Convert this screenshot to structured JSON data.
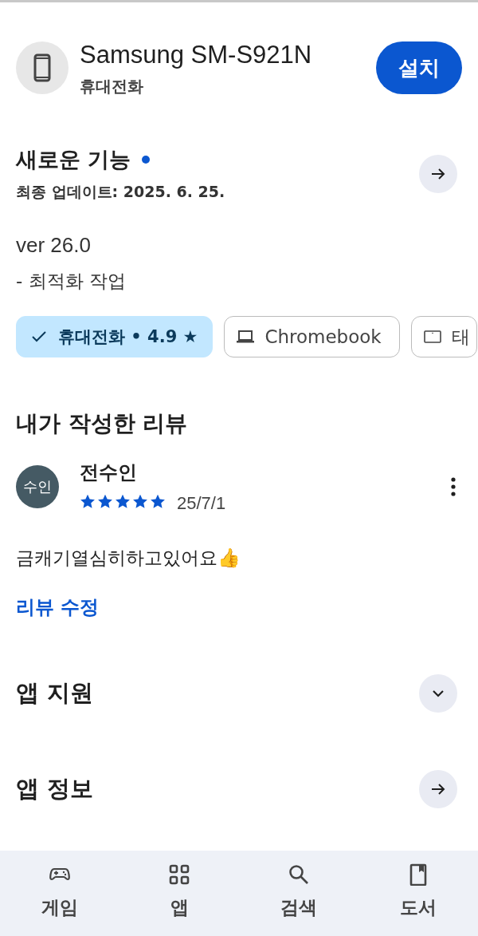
{
  "device": {
    "name": "Samsung SM-S921N",
    "type": "휴대전화",
    "install_label": "설치"
  },
  "whats_new": {
    "title": "새로운 기능",
    "has_update_dot": true,
    "updated": "최종 업데이트: 2025. 6. 25.",
    "version": "ver 26.0",
    "notes": "- 최적화 작업"
  },
  "device_chips": [
    {
      "kind": "phone",
      "label": "휴대전화 • 4.9 ★",
      "selected": true
    },
    {
      "kind": "laptop",
      "label": "Chromebook",
      "selected": false
    },
    {
      "kind": "tablet",
      "label": "태",
      "selected": false
    }
  ],
  "my_review": {
    "title": "내가 작성한 리뷰",
    "avatar": "수인",
    "author": "전수인",
    "stars": 5,
    "date": "25/7/1",
    "text": "금캐기열심히하고있어요👍",
    "edit_link": "리뷰 수정"
  },
  "sections": [
    {
      "title": "앱 지원",
      "kind": "expand"
    },
    {
      "title": "앱 정보",
      "kind": "arrow"
    }
  ],
  "bottom_nav": [
    {
      "kind": "games",
      "label": "게임",
      "selected": false
    },
    {
      "kind": "apps",
      "label": "앱",
      "selected": false
    },
    {
      "kind": "search",
      "label": "검색",
      "selected": false
    },
    {
      "kind": "books",
      "label": "도서",
      "selected": false
    }
  ]
}
